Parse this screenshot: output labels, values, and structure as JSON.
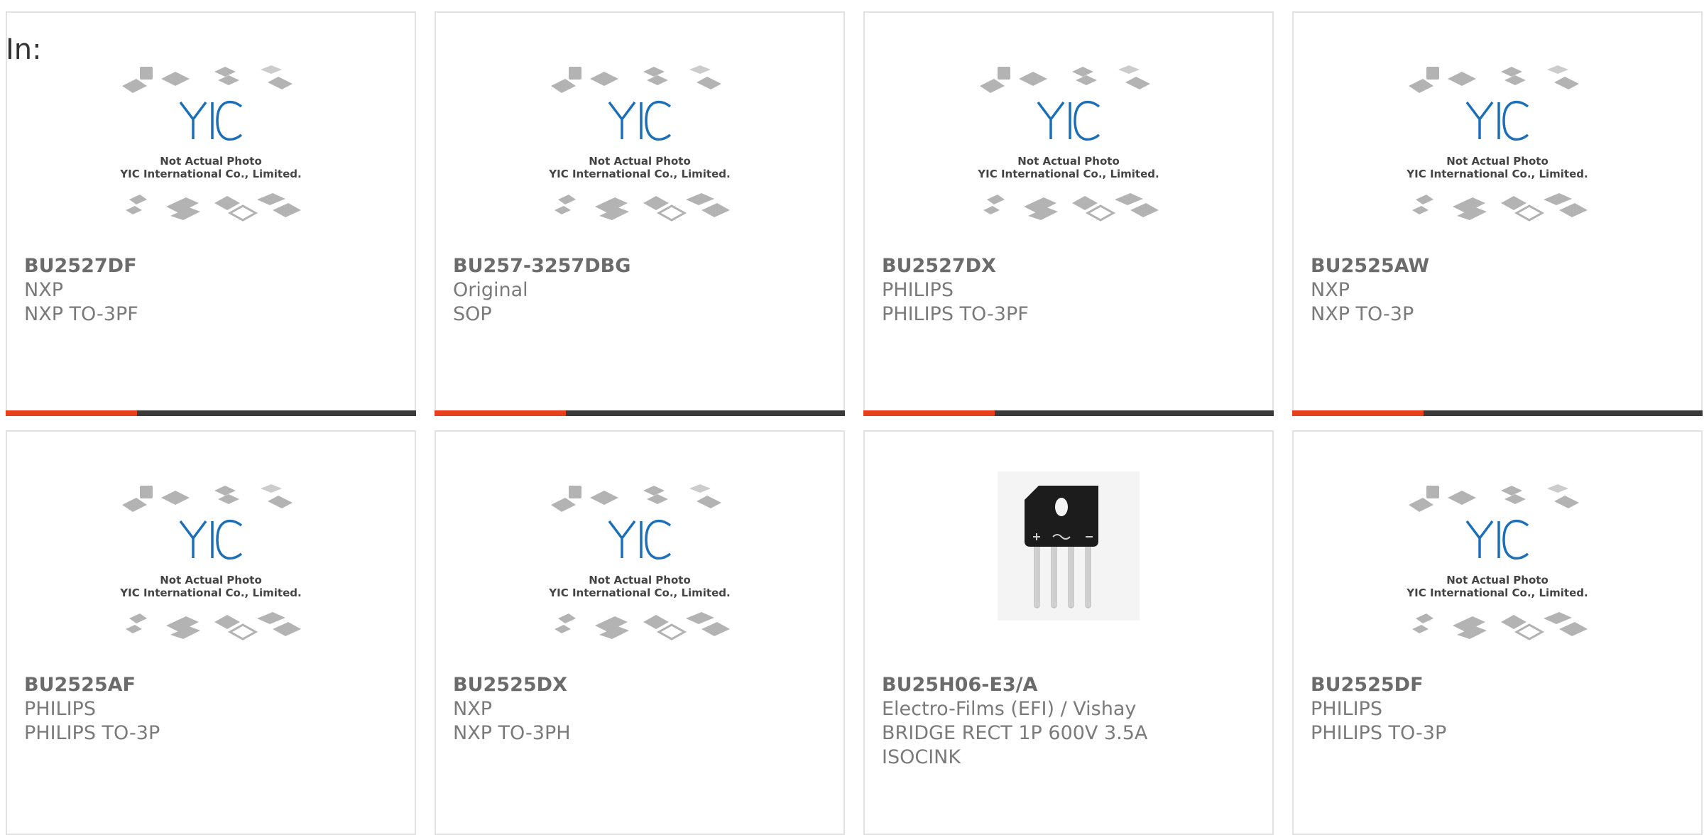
{
  "header": {
    "label": "In:"
  },
  "colors": {
    "accent": "#e8401c",
    "bar": "#3a3a3a",
    "logo_blue": "#1a6fb8",
    "chip_gray": "#9a9a9a"
  },
  "placeholder": {
    "line1": "Not Actual Photo",
    "line2": "YIC International Co., Limited."
  },
  "products": [
    {
      "pn": "BU2527DF",
      "mfr": "NXP",
      "desc": "NXP TO-3PF",
      "desc2": "",
      "image": "placeholder-logo",
      "progress": 0.32
    },
    {
      "pn": "BU257-3257DBG",
      "mfr": "Original",
      "desc": "SOP",
      "desc2": "",
      "image": "placeholder-logo",
      "progress": 0.32
    },
    {
      "pn": "BU2527DX",
      "mfr": "PHILIPS",
      "desc": "PHILIPS TO-3PF",
      "desc2": "",
      "image": "placeholder-logo",
      "progress": 0.32
    },
    {
      "pn": "BU2525AW",
      "mfr": "NXP",
      "desc": "NXP TO-3P",
      "desc2": "",
      "image": "placeholder-logo",
      "progress": 0.32
    },
    {
      "pn": "BU2525AF",
      "mfr": "PHILIPS",
      "desc": "PHILIPS TO-3P",
      "desc2": "",
      "image": "placeholder-logo",
      "progress": 0
    },
    {
      "pn": "BU2525DX",
      "mfr": "NXP",
      "desc": "NXP TO-3PH",
      "desc2": "",
      "image": "placeholder-logo",
      "progress": 0
    },
    {
      "pn": "BU25H06-E3/A",
      "mfr": "Electro-Films (EFI) / Vishay",
      "desc": "BRIDGE RECT 1P 600V 3.5A",
      "desc2": "ISOCINK",
      "image": "bridge-rectifier-photo",
      "progress": 0
    },
    {
      "pn": "BU2525DF",
      "mfr": "PHILIPS",
      "desc": "PHILIPS TO-3P",
      "desc2": "",
      "image": "placeholder-logo",
      "progress": 0
    }
  ]
}
